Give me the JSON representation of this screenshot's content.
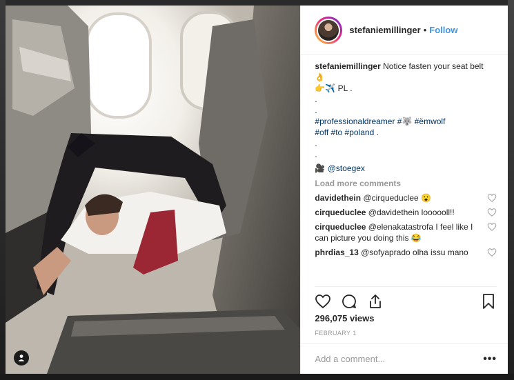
{
  "post": {
    "username": "stefaniemillinger",
    "separator": "•",
    "follow_label": "Follow",
    "caption": {
      "username": "stefaniemillinger",
      "text": "Notice fasten your seat belt",
      "emoji_line_1": "👌",
      "emoji_line_2": "👉✈️ PL .",
      "dot_1": ".",
      "dot_2": ".",
      "hashtags_1": "#professionaldreamer #🐺 #ëmwolf",
      "hashtags_2": "#off #to #poland .",
      "dot_3": ".",
      "dot_4": ".",
      "credit_icon": "🎥",
      "credit_mention": "@stoegex"
    },
    "load_more_label": "Load more comments",
    "comments": [
      {
        "user": "davidethein",
        "text": "@cirqueduclee 😮"
      },
      {
        "user": "cirqueduclee",
        "text": "@davidethein loooooll!!"
      },
      {
        "user": "cirqueduclee",
        "text": "@elenakatastrofa I feel like I can picture you doing this 😂"
      },
      {
        "user": "phrdias_13",
        "text": "@sofyaprado olha issu mano"
      }
    ],
    "views": "296,075 views",
    "date": "FEBRUARY 1",
    "comment_placeholder": "Add a comment...",
    "more_options": "•••"
  },
  "icons": {
    "like": "heart-icon",
    "comment": "comment-icon",
    "share": "share-icon",
    "save": "bookmark-icon",
    "user_tag": "user-icon"
  },
  "colors": {
    "link": "#3897f0",
    "hashtag": "#003569",
    "muted": "#999999",
    "text": "#262626"
  }
}
